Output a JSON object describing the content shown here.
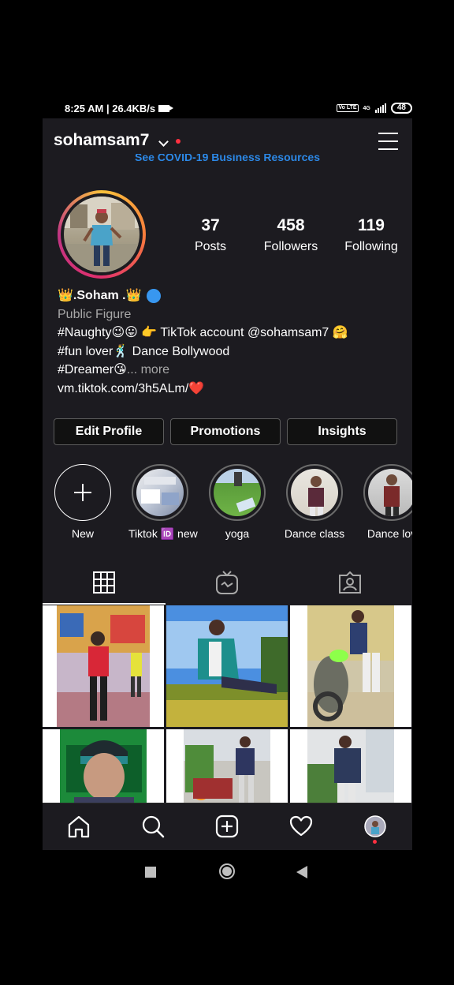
{
  "status": {
    "time_speed": "8:25 AM | 26.4KB/s",
    "network": "4G",
    "volte": "Vo LTE",
    "battery": "48"
  },
  "header": {
    "username": "sohamsam7",
    "banner": "See COVID-19 Business Resources"
  },
  "stats": [
    {
      "value": "37",
      "label": "Posts"
    },
    {
      "value": "458",
      "label": "Followers"
    },
    {
      "value": "119",
      "label": "Following"
    }
  ],
  "bio": {
    "name": "👑.Soham .👑",
    "category": "Public Figure",
    "line1": "#Naughty😉😛  👉 TikTok account @sohamsam7 🤗",
    "line2": "#fun lover🕺 Dance Bollywood",
    "line3": "#Dreamer😘",
    "more": "... more",
    "link": "vm.tiktok.com/3h5ALm/❤️"
  },
  "buttons": {
    "edit": "Edit Profile",
    "promotions": "Promotions",
    "insights": "Insights"
  },
  "highlights": [
    "New",
    "Tiktok 🆔 new",
    "yoga",
    "Dance  class",
    "Dance lov"
  ],
  "colors": {
    "background": "#1c1b20",
    "accent": "#2c88e6",
    "notification": "#ff3040"
  }
}
